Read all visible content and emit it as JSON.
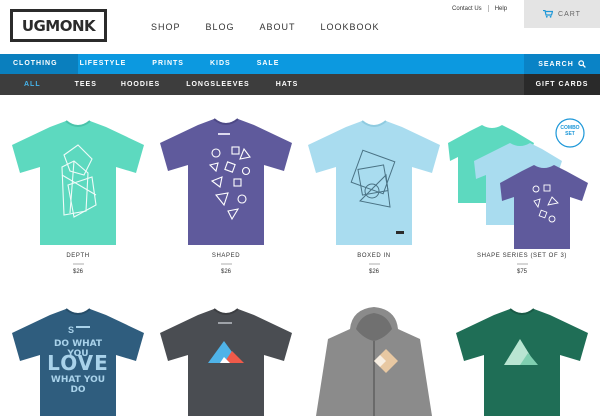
{
  "brand": {
    "logo_text": "UGMONK"
  },
  "main_nav": [
    "SHOP",
    "BLOG",
    "ABOUT",
    "LOOKBOOK"
  ],
  "top_links": [
    "Contact Us",
    "Help"
  ],
  "cart": {
    "label": "CART",
    "icon": "cart-icon"
  },
  "category_nav": {
    "items": [
      "CLOTHING",
      "LIFESTYLE",
      "PRINTS",
      "KIDS",
      "SALE"
    ],
    "active": "CLOTHING",
    "search_label": "SEARCH",
    "accent": "#0c99e0"
  },
  "sub_nav": {
    "items": [
      "ALL",
      "TEES",
      "HOODIES",
      "LONGSLEEVES",
      "HATS"
    ],
    "active": "ALL",
    "gift_cards_label": "GIFT CARDS"
  },
  "products": [
    {
      "name": "DEPTH",
      "price": "$26",
      "color": "#5dd9bf"
    },
    {
      "name": "SHAPED",
      "price": "$26",
      "color": "#5f5a9c"
    },
    {
      "name": "BOXED IN",
      "price": "$26",
      "color": "#a9dcef"
    },
    {
      "name": "SHAPE SERIES (SET OF 3)",
      "price": "$75",
      "badge": "COMBO SET"
    },
    {
      "name": "",
      "price": "",
      "color": "#2f5d7e",
      "graphic_text": [
        "DO WHAT YOU",
        "LOVE",
        "WHAT YOU DO"
      ]
    },
    {
      "name": "",
      "price": "",
      "color": "#4a4d52"
    },
    {
      "name": "",
      "price": "",
      "color": "#8b8b8b"
    },
    {
      "name": "",
      "price": "",
      "color": "#1f6e56"
    }
  ]
}
